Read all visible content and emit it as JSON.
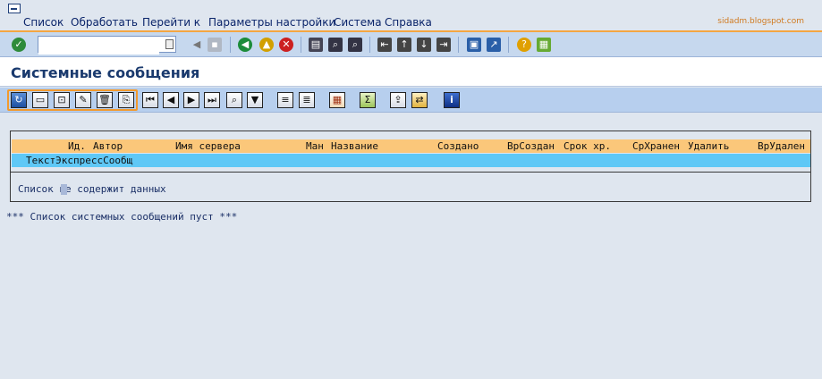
{
  "menu": {
    "items": [
      {
        "label": "Список"
      },
      {
        "label": "Обработать"
      },
      {
        "label": "Перейти к"
      },
      {
        "label": "Параметры настройки"
      },
      {
        "label": "Система"
      },
      {
        "label": "Справка"
      }
    ],
    "watermark": "sidadm.blogspot.com"
  },
  "command_field": {
    "value": ""
  },
  "title": "Системные сообщения",
  "list": {
    "columns": [
      "Ид.",
      "Автор",
      "Имя сервера",
      "Ман",
      "Название",
      "Создано",
      "ВрСоздан",
      "Срок хр.",
      "СрХранен",
      "Удалить",
      "ВрУдален"
    ],
    "row_label": "ТекстЭкспрессСообщ",
    "empty_message": "Список не содержит данных"
  },
  "footer_message": "*** Список системных сообщений пуст ***",
  "colors": {
    "header_bg": "#fbc77a",
    "row_highlight": "#5fc8f6",
    "accent_orange": "#f29a2e",
    "title_text": "#1a3a6e"
  }
}
